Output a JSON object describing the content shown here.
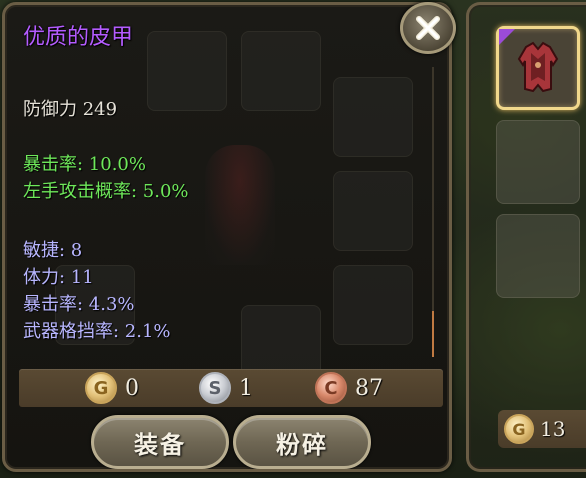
{
  "tooltip": {
    "title": "优质的皮甲",
    "defense": "防御力 249",
    "primary_stats": [
      "暴击率: 10.0%",
      "左手攻击概率: 5.0%"
    ],
    "secondary_stats": [
      "敏捷: 8",
      "体力: 11",
      "暴击率: 4.3%",
      "武器格挡率: 2.1%"
    ],
    "title_color": "#b45cff"
  },
  "currency": {
    "gold": {
      "symbol": "G",
      "value": "0"
    },
    "silver": {
      "symbol": "S",
      "value": "1"
    },
    "copper": {
      "symbol": "C",
      "value": "87"
    }
  },
  "actions": {
    "equip_label": "装备",
    "smash_label": "粉碎"
  },
  "side": {
    "gold_symbol": "G",
    "gold_value": "13",
    "selected_rarity_color": "#9b4bd8"
  },
  "icons": {
    "close": "close-x-icon",
    "item": "leather-armor-icon"
  }
}
